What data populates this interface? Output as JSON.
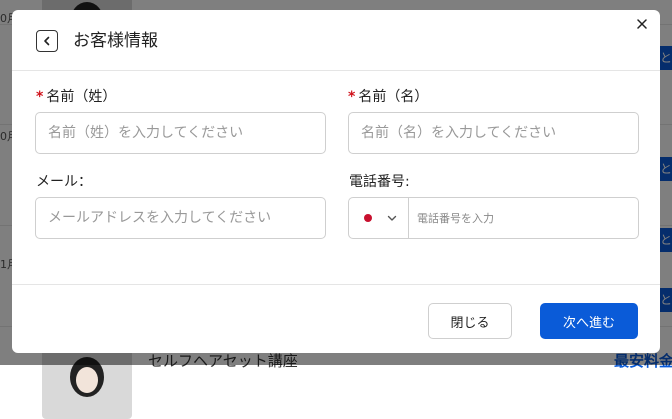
{
  "background": {
    "rows": [
      {
        "date_fragment": "0月"
      },
      {
        "date_fragment": "0月"
      },
      {
        "date_fragment": "1月"
      }
    ],
    "badge_char": "と",
    "bottom_course_title": "セルフヘアセット講座",
    "bottom_price_label": "最安料金",
    "overlay_color": "rgba(0,0,0,0.5)"
  },
  "modal": {
    "title": "お客様情報",
    "back_icon": "chevron-left-icon",
    "close_icon": "close-icon"
  },
  "form": {
    "required_mark": "*",
    "last_name": {
      "label": "名前（姓）",
      "placeholder": "名前（姓）を入力してください",
      "value": ""
    },
    "first_name": {
      "label": "名前（名）",
      "placeholder": "名前（名）を入力してください",
      "value": ""
    },
    "email": {
      "label": "メール：",
      "placeholder": "メールアドレスを入力してください",
      "value": ""
    },
    "phone": {
      "label": "電話番号:",
      "placeholder": "電話番号を入力",
      "value": "",
      "country_flag": "japan-flag-icon",
      "flag_color": "#c8102e"
    }
  },
  "footer": {
    "close_label": "閉じる",
    "next_label": "次へ進む"
  },
  "colors": {
    "primary": "#0a5bd8",
    "required": "#d0121b"
  }
}
